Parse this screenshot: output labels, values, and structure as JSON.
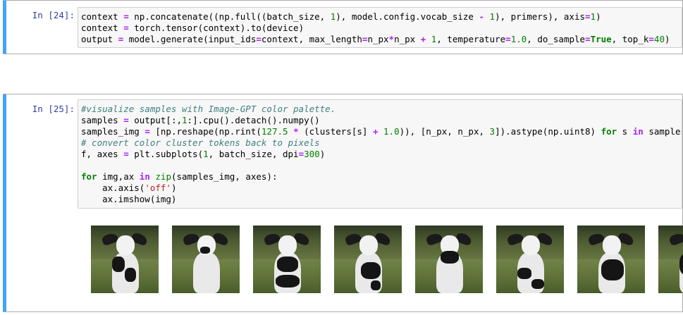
{
  "cells": [
    {
      "prompt": "In [24]:",
      "lines": [
        [
          [
            "t",
            "context "
          ],
          [
            "op",
            "="
          ],
          [
            "t",
            " np.concatenate((np.full((batch_size, "
          ],
          [
            "num",
            "1"
          ],
          [
            "t",
            "), model.config.vocab_size "
          ],
          [
            "op",
            "-"
          ],
          [
            "t",
            " "
          ],
          [
            "num",
            "1"
          ],
          [
            "t",
            "), primers), axis"
          ],
          [
            "op",
            "="
          ],
          [
            "num",
            "1"
          ],
          [
            "t",
            ")"
          ]
        ],
        [
          [
            "t",
            "context "
          ],
          [
            "op",
            "="
          ],
          [
            "t",
            " torch.tensor(context).to(device)"
          ]
        ],
        [
          [
            "t",
            "output "
          ],
          [
            "op",
            "="
          ],
          [
            "t",
            " model.generate(input_ids"
          ],
          [
            "op",
            "="
          ],
          [
            "t",
            "context, max_length"
          ],
          [
            "op",
            "="
          ],
          [
            "t",
            "n_px"
          ],
          [
            "op",
            "*"
          ],
          [
            "t",
            "n_px "
          ],
          [
            "op",
            "+"
          ],
          [
            "t",
            " "
          ],
          [
            "num",
            "1"
          ],
          [
            "t",
            ", temperature"
          ],
          [
            "op",
            "="
          ],
          [
            "num",
            "1.0"
          ],
          [
            "t",
            ", do_sample"
          ],
          [
            "op",
            "="
          ],
          [
            "kw",
            "True"
          ],
          [
            "t",
            ", top_k"
          ],
          [
            "op",
            "="
          ],
          [
            "num",
            "40"
          ],
          [
            "t",
            ")"
          ]
        ]
      ]
    },
    {
      "prompt": "In [25]:",
      "lines": [
        [
          [
            "cm",
            "#visualize samples with Image-GPT color palette."
          ]
        ],
        [
          [
            "t",
            "samples "
          ],
          [
            "op",
            "="
          ],
          [
            "t",
            " output[:,"
          ],
          [
            "num",
            "1"
          ],
          [
            "t",
            ":].cpu().detach().numpy()"
          ]
        ],
        [
          [
            "t",
            "samples_img "
          ],
          [
            "op",
            "="
          ],
          [
            "t",
            " [np.reshape(np.rint("
          ],
          [
            "num",
            "127.5"
          ],
          [
            "t",
            " "
          ],
          [
            "op",
            "*"
          ],
          [
            "t",
            " (clusters[s] "
          ],
          [
            "op",
            "+"
          ],
          [
            "t",
            " "
          ],
          [
            "num",
            "1.0"
          ],
          [
            "t",
            ")), [n_px, n_px, "
          ],
          [
            "num",
            "3"
          ],
          [
            "t",
            "]).astype(np.uint8) "
          ],
          [
            "kw",
            "for"
          ],
          [
            "t",
            " s "
          ],
          [
            "op",
            "in"
          ],
          [
            "t",
            " samples]"
          ]
        ],
        [
          [
            "cm",
            "# convert color cluster tokens back to pixels"
          ]
        ],
        [
          [
            "t",
            "f, axes "
          ],
          [
            "op",
            "="
          ],
          [
            "t",
            " plt.subplots("
          ],
          [
            "num",
            "1"
          ],
          [
            "t",
            ", batch_size, dpi"
          ],
          [
            "op",
            "="
          ],
          [
            "num",
            "300"
          ],
          [
            "t",
            ")"
          ]
        ],
        [
          [
            "t",
            ""
          ]
        ],
        [
          [
            "kw",
            "for"
          ],
          [
            "t",
            " img,ax "
          ],
          [
            "op",
            "in"
          ],
          [
            "t",
            " "
          ],
          [
            "bi",
            "zip"
          ],
          [
            "t",
            "(samples_img, axes):"
          ]
        ],
        [
          [
            "t",
            "    ax.axis("
          ],
          [
            "str",
            "'off'"
          ],
          [
            "t",
            ")"
          ]
        ],
        [
          [
            "t",
            "    ax.imshow(img)"
          ]
        ]
      ]
    }
  ],
  "output_images": {
    "count": 8,
    "items": [
      {
        "name": "sample-1",
        "subject": "dog-photo"
      },
      {
        "name": "sample-2",
        "subject": "dog-photo"
      },
      {
        "name": "sample-3",
        "subject": "dog-photo"
      },
      {
        "name": "sample-4",
        "subject": "dog-photo"
      },
      {
        "name": "sample-5",
        "subject": "dog-photo"
      },
      {
        "name": "sample-6",
        "subject": "dog-photo"
      },
      {
        "name": "sample-7",
        "subject": "dog-photo"
      },
      {
        "name": "sample-8",
        "subject": "dog-photo"
      }
    ]
  },
  "colors": {
    "selected_bar": "#42a5f5",
    "prompt": "#303f9f",
    "code_bg": "#f7f7f7"
  }
}
